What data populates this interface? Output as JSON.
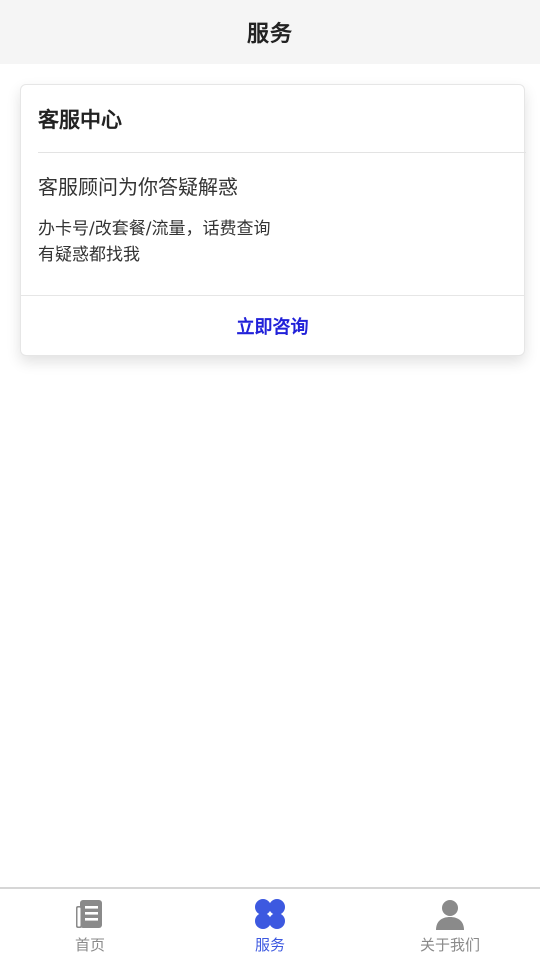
{
  "navbar": {
    "title": "服务"
  },
  "card": {
    "title": "客服中心",
    "subtitle": "客服顾问为你答疑解惑",
    "desc_line1": "办卡号/改套餐/流量，话费查询",
    "desc_line2": "有疑惑都找我",
    "action_label": "立即咨询"
  },
  "tabbar": {
    "tabs": [
      {
        "label": "首页",
        "icon": "news-icon",
        "active": false
      },
      {
        "label": "服务",
        "icon": "grid-icon",
        "active": true
      },
      {
        "label": "关于我们",
        "icon": "user-icon",
        "active": false
      }
    ]
  },
  "colors": {
    "accent": "#3d59e0",
    "link": "#2121d9",
    "inactive": "#8a8a8a"
  }
}
